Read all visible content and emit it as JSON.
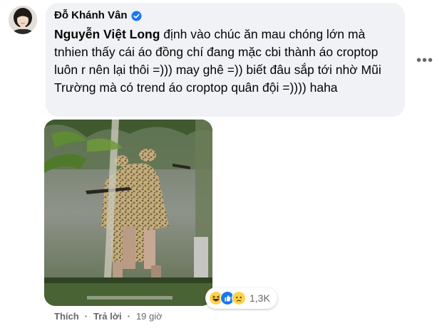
{
  "comment": {
    "author": "Đỗ Khánh Vân",
    "author_verified": true,
    "mention": "Nguyễn Việt Long",
    "text": " định vào chúc ăn mau chóng lớn mà tnhien thấy cái áo đồng chí đang mặc cbi thành áo croptop luôn r nên lại thôi =))) may ghê =)) biết đâu sắp tới nhờ Mũi Trường mà có trend áo croptop quân đội =)))) haha",
    "more_label": "•••"
  },
  "reactions": {
    "icons": [
      "haha-emoji-icon",
      "like-icon",
      "sad-emoji-icon"
    ],
    "count": "1,3K"
  },
  "actions": {
    "like": "Thích",
    "reply": "Trả lời",
    "separator1": "·",
    "separator2": "·",
    "time": "19 giờ"
  },
  "colors": {
    "bubble": "#f0f2f5",
    "secondary_text": "#65676b",
    "verified": "#1877f2"
  }
}
